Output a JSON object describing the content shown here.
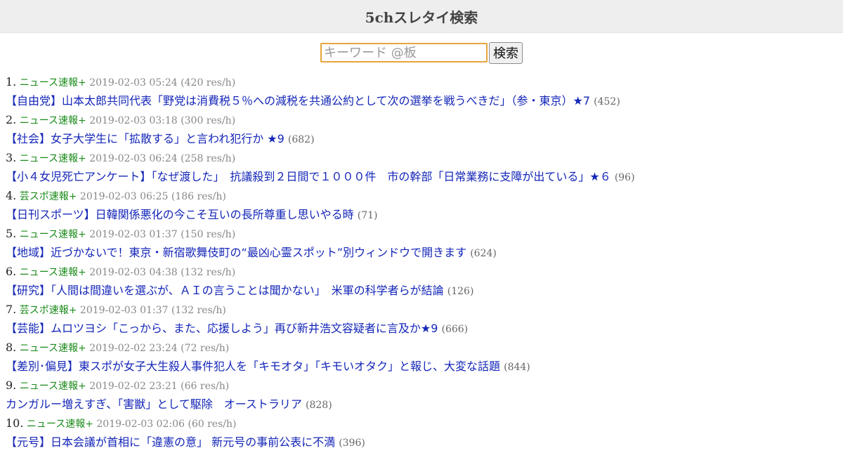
{
  "header": {
    "title": "5chスレタイ検索"
  },
  "search": {
    "placeholder": "キーワード @板",
    "button_label": "検索"
  },
  "results": [
    {
      "num": "1.",
      "board": "ニュース速報+",
      "date": "2019-02-03 05:24",
      "rate": "(420 res/h)",
      "title": "【自由党】山本太郎共同代表「野党は消費税５％への減税を共通公約として次の選挙を戦うべきだ」（参・東京）★7",
      "count": "(452)"
    },
    {
      "num": "2.",
      "board": "ニュース速報+",
      "date": "2019-02-03 03:18",
      "rate": "(300 res/h)",
      "title": "【社会】女子大学生に「拡散する」と言われ犯行か ★9",
      "count": "(682)"
    },
    {
      "num": "3.",
      "board": "ニュース速報+",
      "date": "2019-02-03 06:24",
      "rate": "(258 res/h)",
      "title": "【小４女児死亡アンケート】「なぜ渡した」　抗議殺到２日間で１０００件　市の幹部「日常業務に支障が出ている」★６",
      "count": "(96)"
    },
    {
      "num": "4.",
      "board": "芸スポ速報+",
      "date": "2019-02-03 06:25",
      "rate": "(186 res/h)",
      "title": "【日刊スポーツ】日韓関係悪化の今こそ互いの長所尊重し思いやる時",
      "count": "(71)"
    },
    {
      "num": "5.",
      "board": "ニュース速報+",
      "date": "2019-02-03 01:37",
      "rate": "(150 res/h)",
      "title": "【地域】近づかないで！東京・新宿歌舞伎町の“最凶心霊スポット”別ウィンドウで開きます",
      "count": "(624)"
    },
    {
      "num": "6.",
      "board": "ニュース速報+",
      "date": "2019-02-03 04:38",
      "rate": "(132 res/h)",
      "title": "【研究】「人間は間違いを選ぶが、ＡＩの言うことは聞かない」　米軍の科学者らが結論",
      "count": "(126)"
    },
    {
      "num": "7.",
      "board": "芸スポ速報+",
      "date": "2019-02-03 01:37",
      "rate": "(132 res/h)",
      "title": "【芸能】ムロツヨシ「こっから、また、応援しよう」再び新井浩文容疑者に言及か★9",
      "count": "(666)"
    },
    {
      "num": "8.",
      "board": "ニュース速報+",
      "date": "2019-02-02 23:24",
      "rate": "(72 res/h)",
      "title": "【差別･偏見】東スポが女子大生殺人事件犯人を「キモオタ」｢キモいオタク」と報じ、大変な話題",
      "count": "(844)"
    },
    {
      "num": "9.",
      "board": "ニュース速報+",
      "date": "2019-02-02 23:21",
      "rate": "(66 res/h)",
      "title": "カンガルー増えすぎ、「害獣」として駆除　オーストラリア",
      "count": "(828)"
    },
    {
      "num": "10.",
      "board": "ニュース速報+",
      "date": "2019-02-03 02:06",
      "rate": "(60 res/h)",
      "title": "【元号】日本会議が首相に「違憲の意」 新元号の事前公表に不満",
      "count": "(396)"
    }
  ]
}
